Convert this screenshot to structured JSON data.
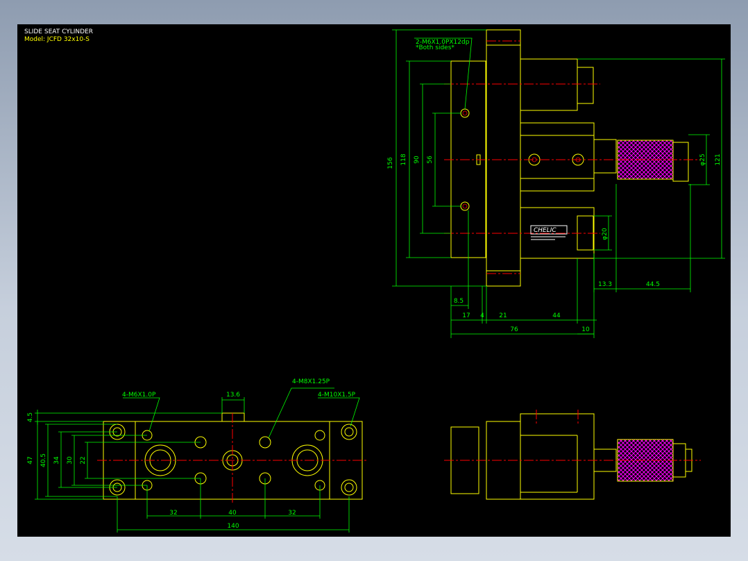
{
  "title_block": {
    "title": "SLIDE SEAT CYLINDER",
    "model": "Model: JCFD 32x10-S"
  },
  "colors": {
    "background": "#000000",
    "outline": "#ffff00",
    "dimension": "#00ff00",
    "centerline": "#ff0000",
    "knurl": "#ff00ff",
    "logo": "#ffffff"
  },
  "side_view": {
    "callout": "2-M6X1.0PX12dp",
    "callout_note": "*Both sides*",
    "logo_text": "CHELIC",
    "dims": {
      "d156": "156",
      "d118": "118",
      "d90": "90",
      "d56": "56",
      "d121": "121",
      "phi25": "φ25",
      "phi20": "φ20",
      "d13_3": "13.3",
      "d44_5": "44.5",
      "d8_5": "8.5",
      "d17": "17",
      "d4": "4",
      "d21": "21",
      "d44": "44",
      "d76": "76",
      "d10": "10"
    }
  },
  "top_view": {
    "callout_m6": "4-M6X1.0P",
    "callout_m8": "4-M8X1.25P",
    "callout_m10": "4-M10X1.5P",
    "dims": {
      "d13_6": "13.6",
      "d4_5": "4.5",
      "d47": "47",
      "d40_5": "40.5",
      "d34": "34",
      "d30": "30",
      "d22": "22",
      "d32a": "32",
      "d40": "40",
      "d32b": "32",
      "d140": "140"
    }
  }
}
